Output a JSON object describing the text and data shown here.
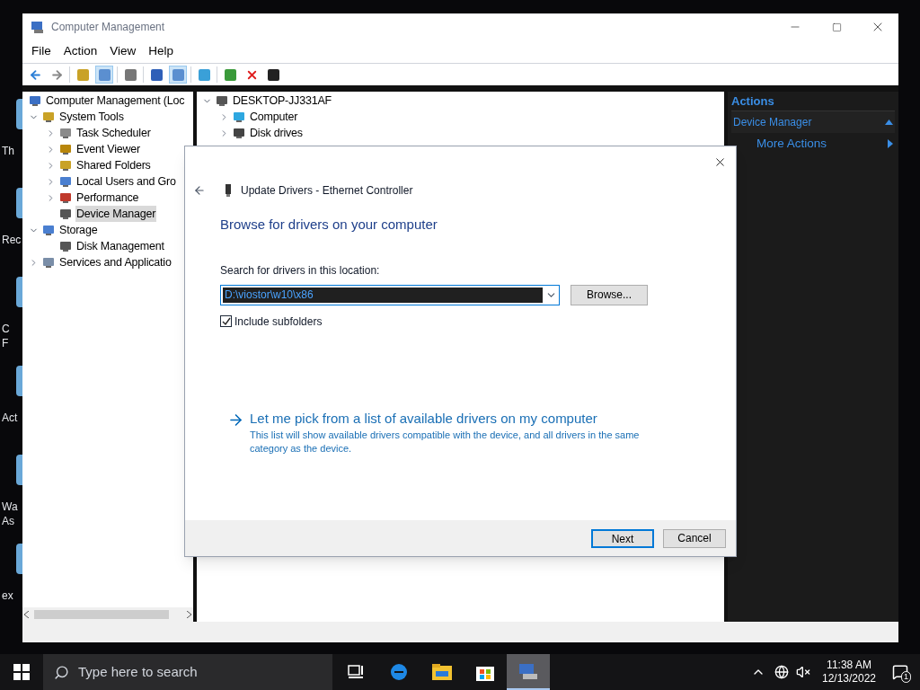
{
  "desktop_icons": [
    {
      "lines": [
        "Th"
      ]
    },
    {
      "lines": [
        "Rec"
      ]
    },
    {
      "lines": [
        "C",
        "F"
      ]
    },
    {
      "lines": [
        "Act"
      ]
    },
    {
      "lines": [
        "Wa",
        "As"
      ]
    },
    {
      "lines": [
        "ex"
      ]
    }
  ],
  "window": {
    "title": "Computer Management"
  },
  "menu": [
    "File",
    "Action",
    "View",
    "Help"
  ],
  "toolbar": [
    {
      "pressed": false
    },
    {
      "pressed": false
    },
    {
      "pressed": false
    },
    {
      "pressed": true
    },
    {
      "pressed": false
    },
    {
      "pressed": false
    },
    {
      "pressed": true
    },
    {
      "pressed": false
    },
    {
      "pressed": false
    },
    {
      "pressed": false
    },
    {
      "pressed": false
    }
  ],
  "console_tree": [
    {
      "label": "Computer Management (Loc",
      "kind": "root",
      "selected": false,
      "children": [
        {
          "label": "System Tools",
          "kind": "node",
          "expanded": true,
          "selected": false,
          "children": [
            {
              "label": "Task Scheduler",
              "kind": "node",
              "expanded": false,
              "selected": false
            },
            {
              "label": "Event Viewer",
              "kind": "node",
              "expanded": false,
              "selected": false
            },
            {
              "label": "Shared Folders",
              "kind": "node",
              "expanded": false,
              "selected": false
            },
            {
              "label": "Local Users and Gro",
              "kind": "node",
              "expanded": false,
              "selected": false
            },
            {
              "label": "Performance",
              "kind": "node",
              "expanded": false,
              "selected": false
            },
            {
              "label": "Device Manager",
              "kind": "leaf",
              "selected": true
            }
          ]
        },
        {
          "label": "Storage",
          "kind": "node",
          "expanded": true,
          "selected": false,
          "children": [
            {
              "label": "Disk Management",
              "kind": "leaf",
              "selected": false
            }
          ]
        },
        {
          "label": "Services and Applicatio",
          "kind": "node",
          "expanded": false,
          "selected": false
        }
      ]
    }
  ],
  "device_tree": [
    {
      "label": "DESKTOP-JJ331AF",
      "kind": "node",
      "expanded": true,
      "selected": false,
      "children": [
        {
          "label": "Computer",
          "kind": "node",
          "expanded": false,
          "selected": false
        },
        {
          "label": "Disk drives",
          "kind": "node",
          "expanded": false,
          "selected": false
        }
      ]
    }
  ],
  "actions": {
    "header": "Actions",
    "section": {
      "label": "Device Manager",
      "expanded": true
    },
    "items": [
      "More Actions"
    ]
  },
  "dialog": {
    "title": "Update Drivers - Ethernet Controller",
    "heading": "Browse for drivers on your computer",
    "field_label": "Search for drivers in this location:",
    "path": {
      "value": "D:\\viostor\\w10\\x86",
      "value_selected": true
    },
    "browse": "Browse...",
    "include_subfolders": {
      "label": "Include subfolders",
      "checked": true
    },
    "pick_link": {
      "label": "Let me pick from a list of available drivers on my computer",
      "description": "This list will show available drivers compatible with the device, and all drivers in the same category as the device."
    },
    "buttons": [
      {
        "label": "Next",
        "kind": "default"
      },
      {
        "label": "Cancel",
        "kind": "normal"
      }
    ]
  },
  "taskbar": {
    "search": {
      "placeholder": "Type here to search"
    },
    "apps": [
      {
        "selected": false
      },
      {
        "selected": false
      },
      {
        "selected": false
      },
      {
        "selected": false
      },
      {
        "selected": true
      }
    ],
    "time": "11:38 AM",
    "date": "12/13/2022",
    "notifications": "1"
  }
}
